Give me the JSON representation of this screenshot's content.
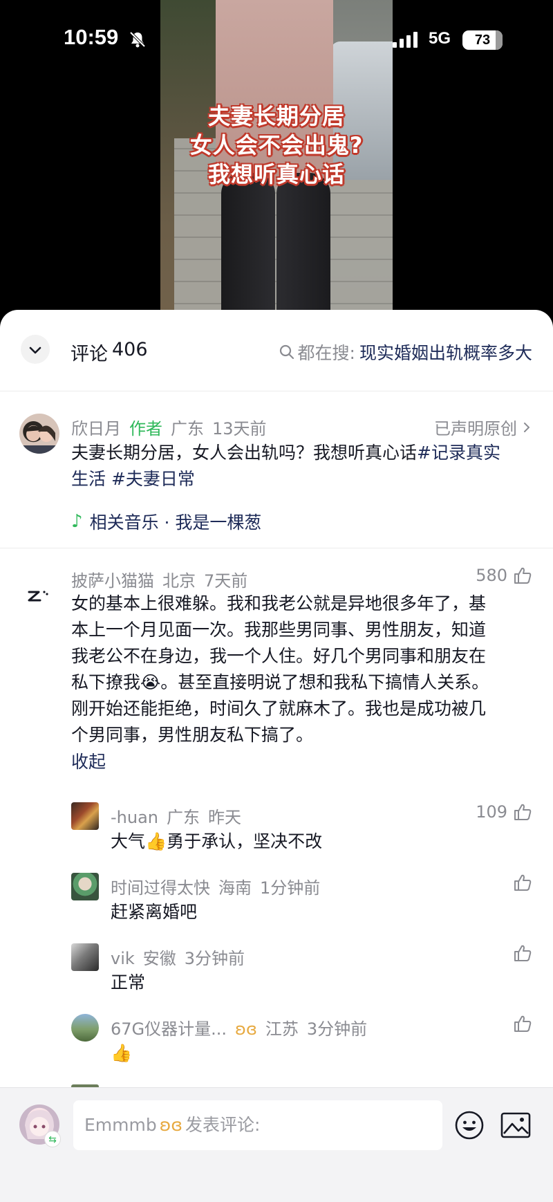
{
  "status_bar": {
    "time": "10:59",
    "network": "5G",
    "battery": "73"
  },
  "video": {
    "caption_lines": [
      "夫妻长期分居",
      "女人会不会出鬼?",
      "我想听真心话"
    ]
  },
  "header": {
    "title": "评论",
    "count": "406",
    "search_prefix": "都在搜:",
    "search_keyword": "现实婚姻出轨概率多大"
  },
  "post": {
    "author": "欣日月",
    "author_tag": "作者",
    "location": "广东",
    "time": "13天前",
    "original_label": "已声明原创",
    "text_line1_plain": "夫妻长期分居，女人会出轨吗？我想听真心话",
    "text_line1_tag": "#记录真实",
    "text_line2_tag1": "生活",
    "text_line2_tag2": "#夫妻日常",
    "music_label": "相关音乐 · 我是一棵葱"
  },
  "comments": [
    {
      "user": "披萨小猫猫",
      "location": "北京",
      "time": "7天前",
      "likes": "580",
      "lines": [
        "女的基本上很难躲。我和我老公就是异地很多年了，基",
        "本上一个月见面一次。我那些男同事、男性朋友，知道",
        "我老公不在身边，我一个人住。好几个男同事和朋友在",
        "私下撩我😭。甚至直接明说了想和我私下搞情人关系。",
        "刚开始还能拒绝，时间久了就麻木了。我也是成功被几",
        "个男同事，男性朋友私下搞了。"
      ],
      "collapse_label": "收起"
    }
  ],
  "replies": [
    {
      "user": "-huan",
      "location": "广东",
      "time": "昨天",
      "likes": "109",
      "text": "大气👍勇于承认，坚决不改"
    },
    {
      "user": "时间过得太快",
      "location": "海南",
      "time": "1分钟前",
      "likes": "",
      "text": "赶紧离婚吧"
    },
    {
      "user": "vik",
      "location": "安徽",
      "time": "3分钟前",
      "likes": "",
      "text": "正常"
    },
    {
      "user": "67G仪器计量...",
      "location": "江苏",
      "time": "3分钟前",
      "likes": "",
      "text": "👍"
    }
  ],
  "input_bar": {
    "username": "Emmmb",
    "placeholder": "发表评论:"
  },
  "icons": {
    "bell_slash": "bell-slash-icon",
    "signal": "signal-icon",
    "chevron_down": "chevron-down-icon",
    "search": "search-icon",
    "chevron_right": "chevron-right-icon",
    "music_note": "music-note-icon",
    "thumb_up": "thumb-up-icon",
    "butterfly": "butterfly-icon",
    "emoji": "emoji-icon",
    "image": "image-icon"
  },
  "colors": {
    "accent_link": "#1e2b58",
    "author_tag": "#2fb85a",
    "meta_gray": "#8a8b91",
    "caption_outline": "#c0392b"
  }
}
